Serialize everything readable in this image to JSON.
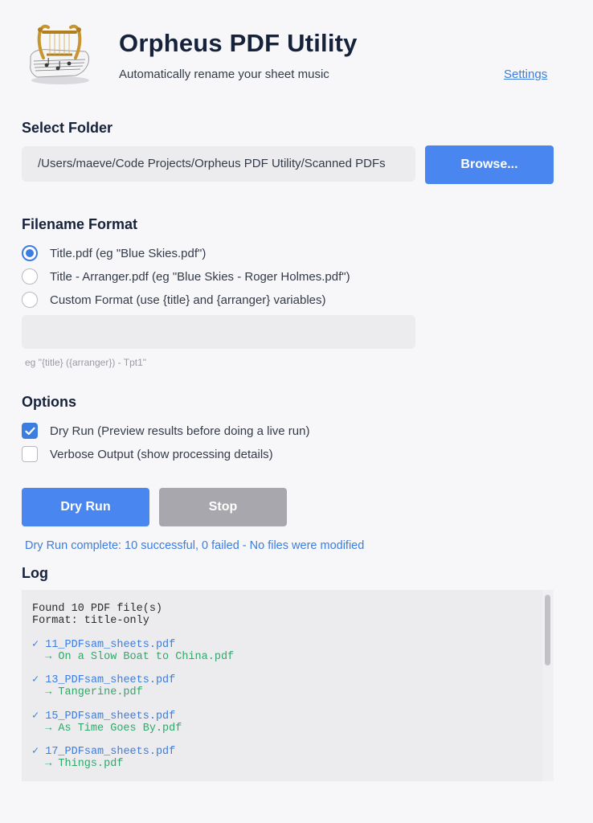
{
  "app": {
    "title": "Orpheus PDF Utility",
    "subtitle": "Automatically rename your sheet music",
    "settings_label": "Settings",
    "logo_icon": "lyre-sheet-music-icon"
  },
  "folder": {
    "section_title": "Select Folder",
    "path": "/Users/maeve/Code Projects/Orpheus PDF Utility/Scanned PDFs",
    "browse_label": "Browse..."
  },
  "format": {
    "section_title": "Filename Format",
    "options": [
      {
        "label": "Title.pdf (eg \"Blue Skies.pdf\")",
        "selected": true
      },
      {
        "label": "Title - Arranger.pdf (eg \"Blue Skies - Roger Holmes.pdf\")",
        "selected": false
      },
      {
        "label": "Custom Format (use {title} and {arranger} variables)",
        "selected": false
      }
    ],
    "custom_value": "",
    "hint": "eg \"{title} ({arranger}) - Tpt1\""
  },
  "options": {
    "section_title": "Options",
    "items": [
      {
        "label": "Dry Run (Preview results before doing a live run)",
        "checked": true
      },
      {
        "label": "Verbose Output (show processing details)",
        "checked": false
      }
    ]
  },
  "actions": {
    "dry_run_label": "Dry Run",
    "stop_label": "Stop"
  },
  "status": {
    "message": "Dry Run complete: 10 successful, 0 failed - No files were modified"
  },
  "log": {
    "section_title": "Log",
    "header_lines": [
      "Found 10 PDF file(s)",
      "Format: title-only"
    ],
    "entries": [
      {
        "source": "✓ 11_PDFsam_sheets.pdf",
        "result": "  → On a Slow Boat to China.pdf"
      },
      {
        "source": "✓ 13_PDFsam_sheets.pdf",
        "result": "  → Tangerine.pdf"
      },
      {
        "source": "✓ 15_PDFsam_sheets.pdf",
        "result": "  → As Time Goes By.pdf"
      },
      {
        "source": "✓ 17_PDFsam_sheets.pdf",
        "result": "  → Things.pdf"
      }
    ]
  },
  "colors": {
    "accent": "#4a86f0",
    "link": "#3b7de0",
    "success": "#2fa86a",
    "disabled": "#a7a7ad",
    "background": "#f7f7fa",
    "field": "#ececef"
  }
}
